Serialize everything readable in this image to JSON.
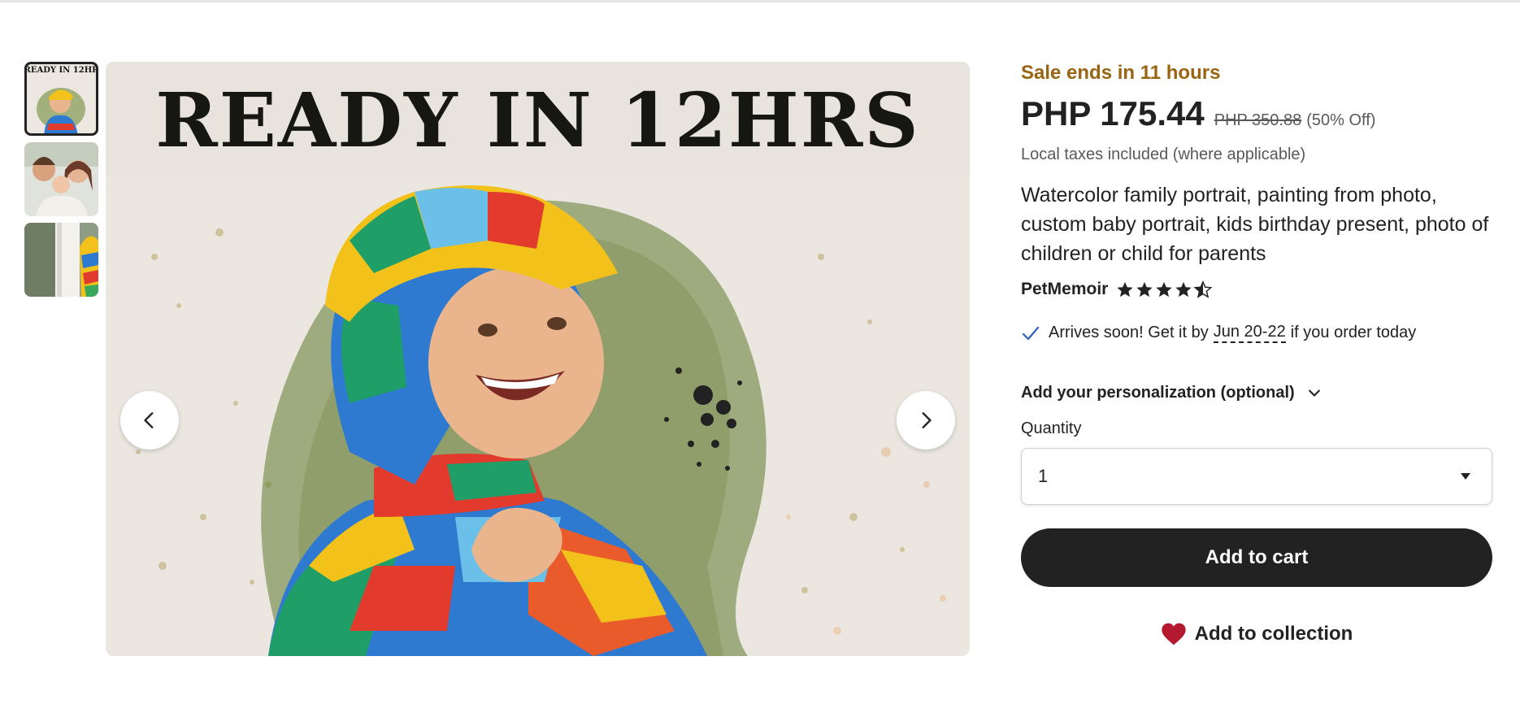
{
  "gallery": {
    "overlay_title": "READY IN 12HRS",
    "thumb_text": "READY IN 12HR",
    "thumbnails": [
      "thumb-1",
      "thumb-2",
      "thumb-3"
    ],
    "prev_icon": "chevron-left-icon",
    "next_icon": "chevron-right-icon"
  },
  "listing": {
    "sale_text": "Sale ends in 11 hours",
    "price": "PHP 175.44",
    "original_price": "PHP 350.88",
    "discount": "(50% Off)",
    "taxes_note": "Local taxes included (where applicable)",
    "title": "Watercolor family portrait, painting from photo, custom baby portrait, kids birthday present, photo of children or child for parents",
    "shop_name": "PetMemoir",
    "rating_stars": 4.5
  },
  "delivery": {
    "prefix": "Arrives soon! Get it by",
    "date": "Jun 20-22",
    "suffix": "if you order today"
  },
  "personalization": {
    "label": "Add your personalization (optional)"
  },
  "quantity": {
    "label": "Quantity",
    "selected": "1"
  },
  "actions": {
    "add_to_cart": "Add to cart",
    "add_to_collection": "Add to collection"
  },
  "colors": {
    "sale": "#9a6412",
    "heart": "#b3192f",
    "button_dark": "#222222"
  }
}
